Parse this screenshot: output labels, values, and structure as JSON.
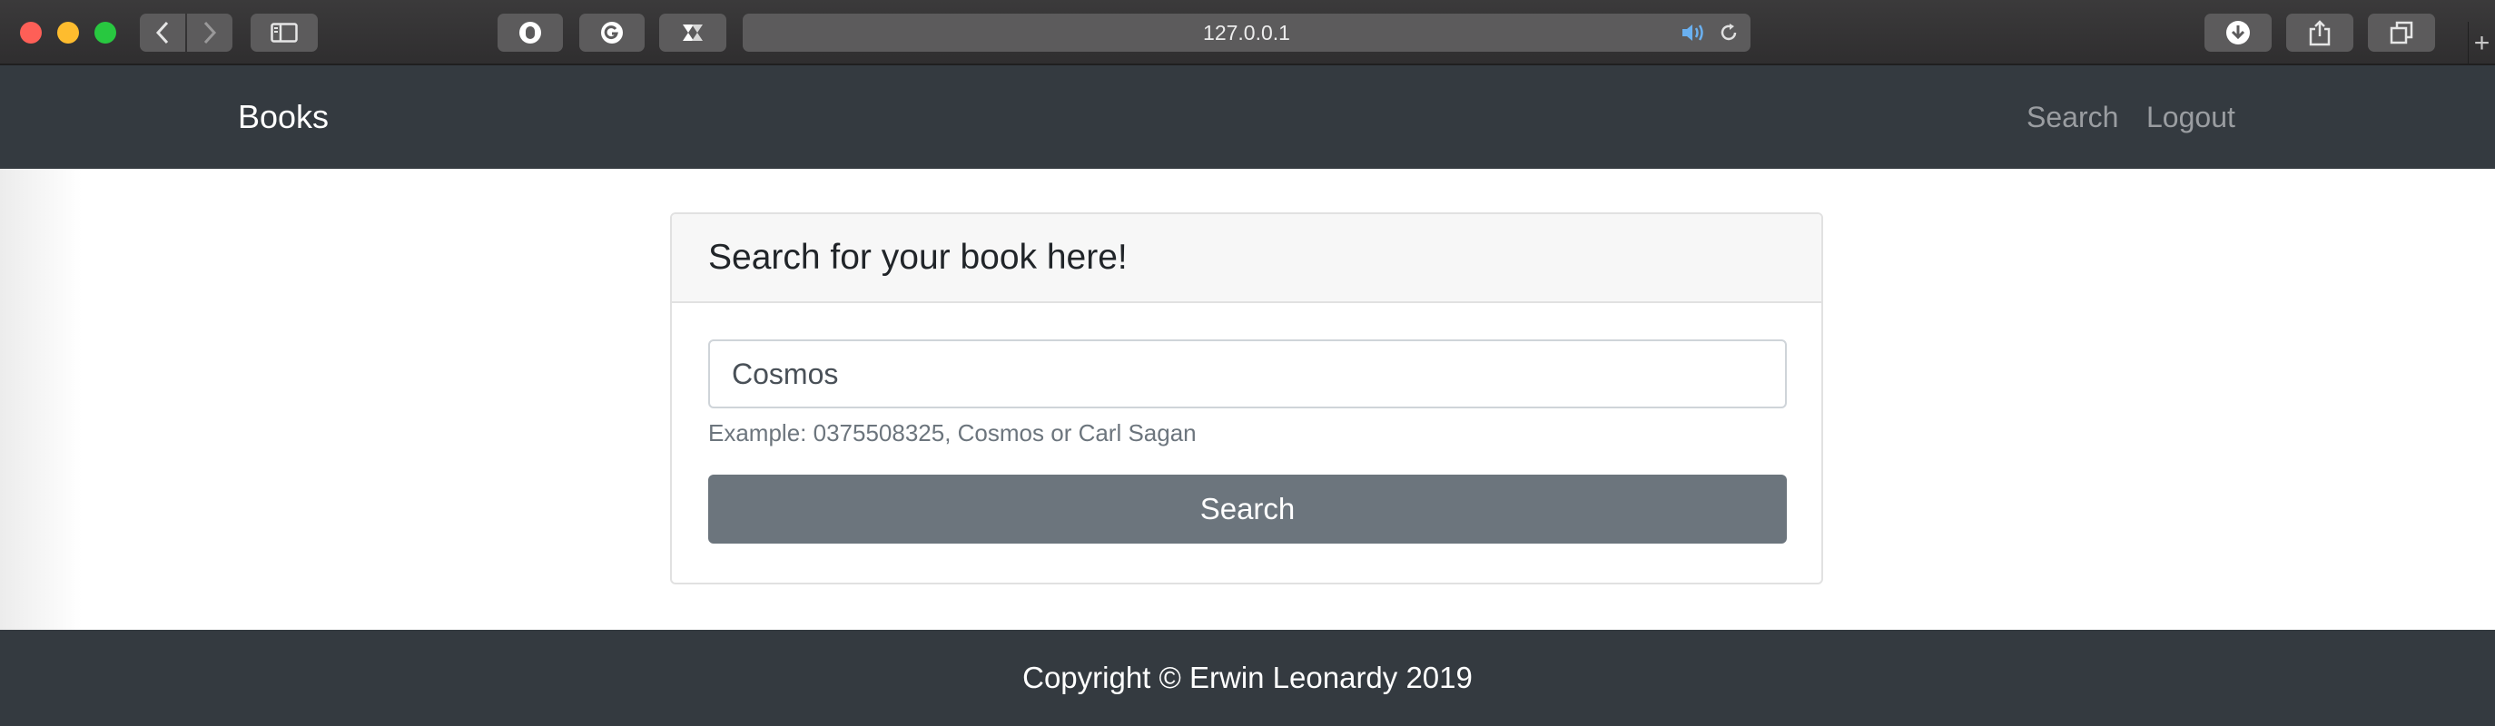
{
  "browser": {
    "url": "127.0.0.1",
    "icons": {
      "back": "chevron-left-icon",
      "forward": "chevron-right-icon",
      "sidebar": "sidebar-icon",
      "ext1": "ghostery-icon",
      "ext2": "grammarly-icon",
      "ext3": "extension-icon",
      "audio": "speaker-icon",
      "reload": "reload-icon",
      "download": "download-icon",
      "share": "share-icon",
      "tabs": "tabs-overview-icon",
      "new_tab": "+"
    }
  },
  "navbar": {
    "brand": "Books",
    "links": [
      "Search",
      "Logout"
    ]
  },
  "card": {
    "title": "Search for your book here!",
    "input_value": "Cosmos",
    "help_text": "Example: 0375508325, Cosmos or Carl Sagan",
    "button_label": "Search"
  },
  "footer": {
    "text": "Copyright © Erwin Leonardy 2019"
  },
  "colors": {
    "navbar_bg": "#343a40",
    "button_bg": "#6c757d",
    "card_header_bg": "#f7f7f7"
  }
}
